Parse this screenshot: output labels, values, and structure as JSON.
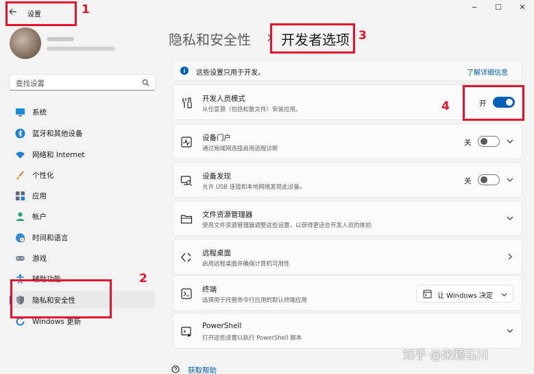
{
  "window": {
    "title": "设置",
    "controls": {
      "minimize": "−",
      "maximize": "☐",
      "close": "✕"
    }
  },
  "search": {
    "placeholder": "查找设置"
  },
  "nav": [
    {
      "label": "系统",
      "icon": "monitor-icon"
    },
    {
      "label": "蓝牙和其他设备",
      "icon": "bluetooth-icon"
    },
    {
      "label": "网络和 Internet",
      "icon": "wifi-icon"
    },
    {
      "label": "个性化",
      "icon": "brush-icon"
    },
    {
      "label": "应用",
      "icon": "apps-icon"
    },
    {
      "label": "帐户",
      "icon": "person-icon"
    },
    {
      "label": "时间和语言",
      "icon": "globe-clock-icon"
    },
    {
      "label": "游戏",
      "icon": "gamepad-icon"
    },
    {
      "label": "辅助功能",
      "icon": "accessibility-icon"
    },
    {
      "label": "隐私和安全性",
      "icon": "shield-icon",
      "active": true
    },
    {
      "label": "Windows 更新",
      "icon": "update-icon"
    }
  ],
  "breadcrumb": {
    "parent": "隐私和安全性",
    "current": "开发者选项"
  },
  "info": {
    "text": "这些设置只用于开发。",
    "link": "了解详细信息"
  },
  "cards": [
    {
      "title": "开发人员模式",
      "desc": "从任意源（包括松散文件）安装应用。",
      "icon": "developer-tools-icon",
      "toggle": "on",
      "toggle_label": "开"
    },
    {
      "title": "设备门户",
      "desc": "通过局域网连接启用远程诊断",
      "icon": "device-portal-icon",
      "toggle": "off",
      "toggle_label": "关",
      "chevron": "down"
    },
    {
      "title": "设备发现",
      "desc": "允许 USB 连接和本地网络发现此设备。",
      "icon": "device-discovery-icon",
      "toggle": "off",
      "toggle_label": "关",
      "chevron": "down"
    },
    {
      "title": "文件资源管理器",
      "desc": "使用文件资源管理器调整这些设置，以获得更适合开发人员的体验",
      "icon": "folder-icon",
      "chevron": "down"
    },
    {
      "title": "远程桌面",
      "desc": "启用远程桌面并确保计算机可用性",
      "icon": "remote-desktop-icon",
      "chevron": "right"
    },
    {
      "title": "终端",
      "desc": "选择用于托管命令行应用的默认终端应用",
      "icon": "terminal-icon",
      "dropdown": "让 Windows 决定"
    },
    {
      "title": "PowerShell",
      "desc": "打开这些设置以执行 PowerShell 脚本",
      "icon": "powershell-icon",
      "chevron": "down"
    }
  ],
  "help": {
    "text": "获取帮助"
  },
  "watermark": "知乎 @来颗石川",
  "annotations": [
    "1",
    "2",
    "3",
    "4"
  ],
  "colors": {
    "accent": "#005fb8",
    "annotation": "#e8102a",
    "background": "#f3f3f3"
  }
}
